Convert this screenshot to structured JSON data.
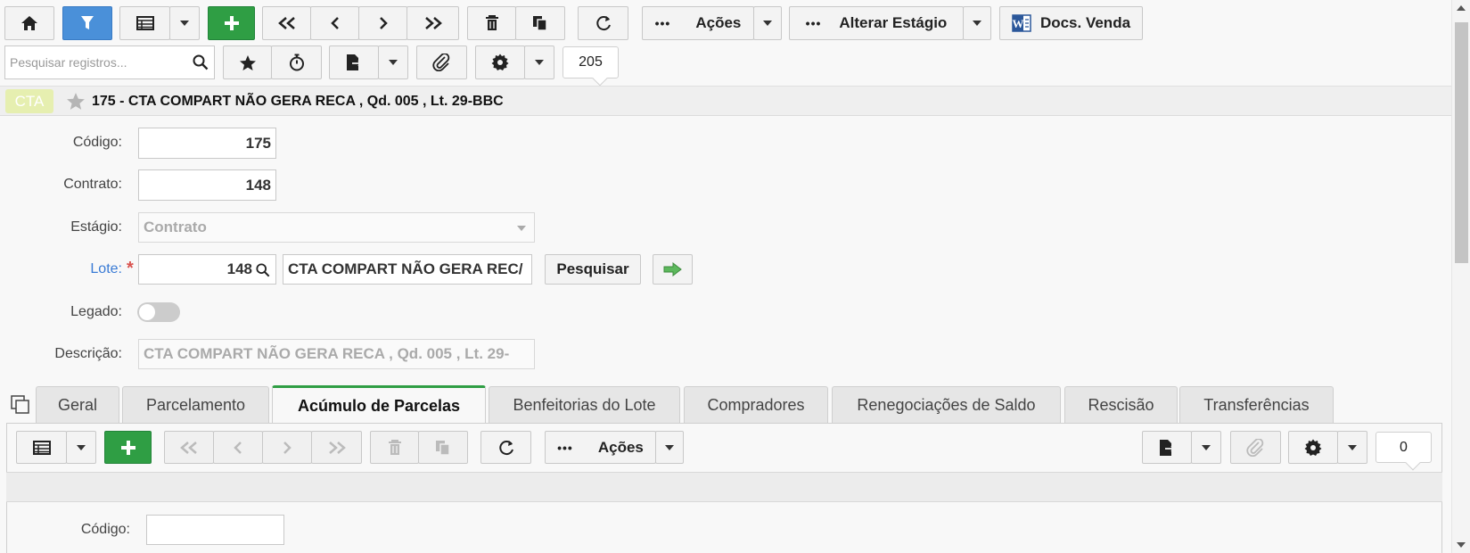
{
  "toolbar": {
    "acoes_label": "Ações",
    "alterar_estagio_label": "Alterar Estágio",
    "docs_venda_label": "Docs. Venda",
    "record_count": "205"
  },
  "search": {
    "placeholder": "Pesquisar registros..."
  },
  "record": {
    "badge": "CTA",
    "title": "175 - CTA COMPART NÃO GERA RECA , Qd. 005 , Lt. 29-BBC"
  },
  "form": {
    "codigo_label": "Código:",
    "codigo_value": "175",
    "contrato_label": "Contrato:",
    "contrato_value": "148",
    "estagio_label": "Estágio:",
    "estagio_value": "Contrato",
    "lote_label": "Lote:",
    "lote_required": "*",
    "lote_value": "148",
    "lote_description": "CTA COMPART NÃO GERA REC/",
    "pesquisar_label": "Pesquisar",
    "legado_label": "Legado:",
    "legado_on": false,
    "descricao_label": "Descrição:",
    "descricao_value": "CTA COMPART NÃO GERA RECA ,  Qd. 005 ,  Lt. 29-"
  },
  "tabs": [
    {
      "label": "Geral"
    },
    {
      "label": "Parcelamento"
    },
    {
      "label": "Acúmulo de Parcelas",
      "active": true
    },
    {
      "label": "Benfeitorias do Lote"
    },
    {
      "label": "Compradores"
    },
    {
      "label": "Renegociações de Saldo"
    },
    {
      "label": "Rescisão"
    },
    {
      "label": "Transferências"
    }
  ],
  "subpanel": {
    "acoes_label": "Ações",
    "record_count": "0",
    "codigo_label": "Código:",
    "codigo_value": ""
  },
  "colors": {
    "accent_green": "#2f9e44",
    "filter_blue": "#4a90d9",
    "link_blue": "#3a7bd5"
  }
}
